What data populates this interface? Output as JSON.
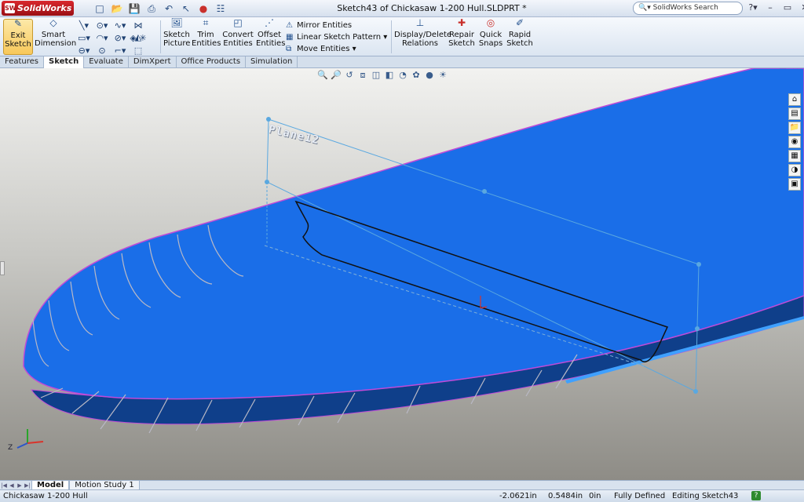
{
  "app": {
    "name": "SolidWorks"
  },
  "window": {
    "title": "Sketch43 of Chickasaw 1-200 Hull.SLDPRT *"
  },
  "search": {
    "placeholder": "SolidWorks Search"
  },
  "ribbon": {
    "exit_sketch": "Exit Sketch",
    "smart_dimension": "Smart Dimension",
    "sketch_picture": "Sketch Picture",
    "trim_entities": "Trim Entities",
    "convert_entities": "Convert Entities",
    "offset_entities": "Offset Entities",
    "mirror_entities": "Mirror Entities",
    "linear_sketch_pattern": "Linear Sketch Pattern",
    "move_entities": "Move Entities",
    "display_delete_relations": "Display/Delete Relations",
    "repair_sketch": "Repair Sketch",
    "quick_snaps": "Quick Snaps",
    "rapid_sketch": "Rapid Sketch"
  },
  "tabs": [
    {
      "label": "Features"
    },
    {
      "label": "Sketch"
    },
    {
      "label": "Evaluate"
    },
    {
      "label": "DimXpert"
    },
    {
      "label": "Office Products"
    },
    {
      "label": "Simulation"
    }
  ],
  "viewport": {
    "plane_label": "Plane12"
  },
  "bottom_tabs": [
    {
      "label": "Model"
    },
    {
      "label": "Motion Study 1"
    }
  ],
  "status": {
    "document": "Chickasaw 1-200 Hull",
    "x": "-2.0621in",
    "y": "0.5484in",
    "z": "0in",
    "definition": "Fully Defined",
    "editing": "Editing Sketch43"
  },
  "colors": {
    "hull_deck": "#1a6ee8",
    "hull_side": "#0f3f8a",
    "edge": "#c04ad8"
  },
  "icons": [
    "solidworks-logo",
    "new-icon",
    "open-icon",
    "save-icon",
    "print-icon",
    "undo-icon",
    "select-icon",
    "rebuild-icon",
    "options-icon",
    "search-icon",
    "help-icon",
    "minimize-icon",
    "restore-icon",
    "close-icon"
  ]
}
